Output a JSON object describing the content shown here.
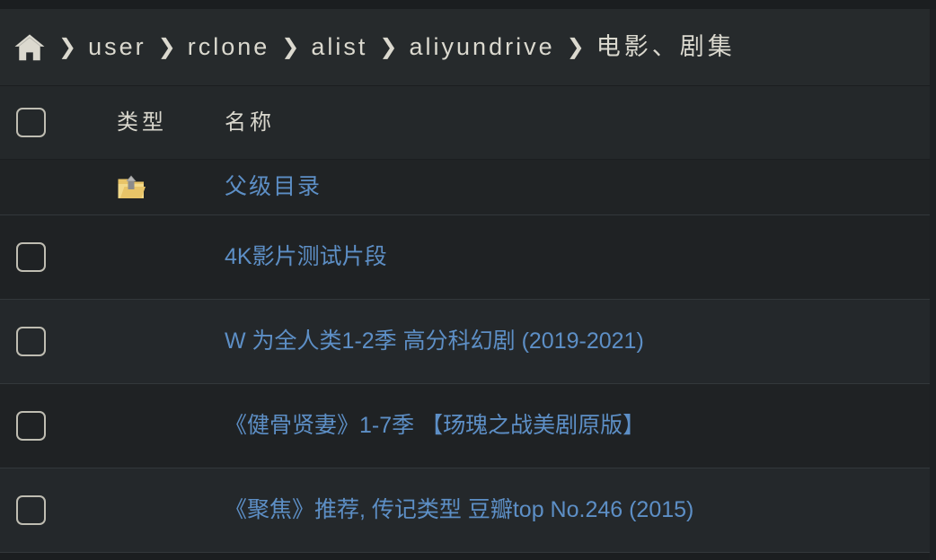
{
  "theme": {
    "page_bg": "#1b1e20",
    "bar_bg": "#262a2c",
    "row_bg_a": "#1f2224",
    "row_bg_b": "#24282b",
    "row_border": "#33383b",
    "text_light": "#dbd9cf",
    "link_blue": "#5d8fc6",
    "folder_yellow": "#e8c468"
  },
  "breadcrumb": {
    "home_icon": "home-icon",
    "separator": "❯",
    "items": [
      {
        "label": "user",
        "cjk": false
      },
      {
        "label": "rclone",
        "cjk": false
      },
      {
        "label": "alist",
        "cjk": false
      },
      {
        "label": "aliyundrive",
        "cjk": false
      },
      {
        "label": "电影、剧集",
        "cjk": true
      }
    ]
  },
  "table": {
    "headers": {
      "select_all": "",
      "type": "类型",
      "name": "名称"
    },
    "parent_row": {
      "icon": "folder-up-icon",
      "name": "父级目录"
    },
    "rows": [
      {
        "name": "4K影片测试片段",
        "checked": false,
        "type_icon": ""
      },
      {
        "name": "W 为全人类1-2季 高分科幻剧 (2019-2021)",
        "checked": false,
        "type_icon": ""
      },
      {
        "name": "《健骨贤妻》1-7季 【玚瑰之战美剧原版】",
        "checked": false,
        "type_icon": ""
      },
      {
        "name": "《聚焦》推荐, 传记类型 豆瓣top No.246 (2015)",
        "checked": false,
        "type_icon": ""
      }
    ]
  }
}
